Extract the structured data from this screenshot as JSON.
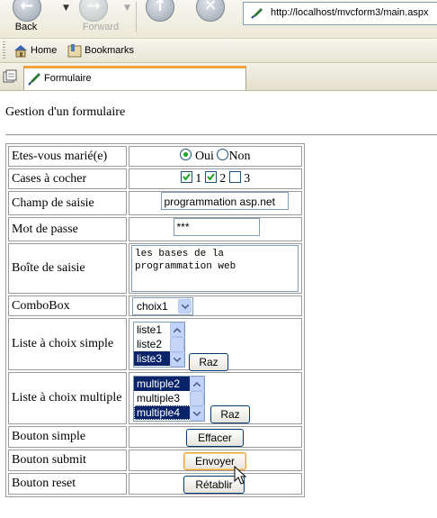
{
  "browser": {
    "back_label": "Back",
    "forward_label": "Forward",
    "url": "http://localhost/mvcform3/main.aspx",
    "links": [
      {
        "label": "Home",
        "icon": "home-icon"
      },
      {
        "label": "Bookmarks",
        "icon": "bookmarks-icon"
      }
    ],
    "tab_title": "Formulaire"
  },
  "page": {
    "title": "Gestion d'un formulaire"
  },
  "form": {
    "marie": {
      "label": "Etes-vous marié(e)",
      "opt1": "Oui",
      "opt2": "Non",
      "selected": "Oui"
    },
    "cases": {
      "label": "Cases à cocher",
      "c1": "1",
      "c2": "2",
      "c3": "3",
      "checked": [
        "1",
        "2"
      ]
    },
    "champ": {
      "label": "Champ de saisie",
      "value": "programmation asp.net"
    },
    "mdp": {
      "label": "Mot de passe",
      "value": "***"
    },
    "boite": {
      "label": "Boîte de saisie",
      "line1": "les bases de la",
      "line2": "programmation web"
    },
    "combo": {
      "label": "ComboBox",
      "value": "choix1"
    },
    "liste_simple": {
      "label": "Liste à choix simple",
      "items": [
        "liste1",
        "liste2",
        "liste3"
      ],
      "selected": "liste3",
      "button": "Raz"
    },
    "liste_multiple": {
      "label": "Liste à choix multiple",
      "items": [
        "multiple2",
        "multiple3",
        "multiple4"
      ],
      "selected": [
        "multiple2",
        "multiple4"
      ],
      "button": "Raz"
    },
    "bouton_simple": {
      "label": "Bouton simple",
      "button": "Effacer"
    },
    "bouton_submit": {
      "label": "Bouton submit",
      "button": "Envoyer"
    },
    "bouton_reset": {
      "label": "Bouton reset",
      "button": "Rétablir"
    }
  },
  "colors": {
    "selection": "#0a246a",
    "tab_accent": "#f2a23a",
    "control_border": "#7f9db9"
  }
}
